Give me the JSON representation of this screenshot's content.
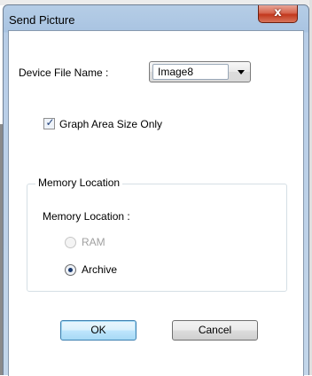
{
  "window": {
    "title": "Send Picture",
    "close_glyph": "x"
  },
  "device_file": {
    "label": "Device File Name :",
    "selected": "Image8"
  },
  "graph_area": {
    "label": "Graph Area Size Only",
    "checked": true,
    "check_glyph": "✓"
  },
  "memory": {
    "group_label": "Memory Location",
    "inner_label": "Memory Location :",
    "options": [
      {
        "label": "RAM",
        "selected": false,
        "enabled": false
      },
      {
        "label": "Archive",
        "selected": true,
        "enabled": true
      }
    ]
  },
  "buttons": {
    "ok": "OK",
    "cancel": "Cancel"
  },
  "colors": {
    "title_bar": "#a9c4e2",
    "close_button": "#c2381c",
    "default_button_border": "#3c7fb1"
  }
}
